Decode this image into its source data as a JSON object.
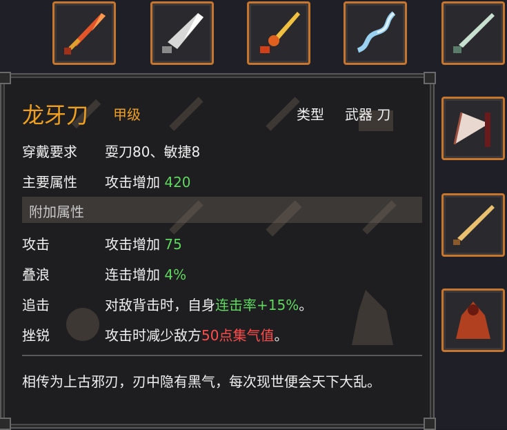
{
  "item": {
    "name": "龙牙刀",
    "grade": "甲级",
    "type_label": "类型",
    "type_value": "武器 刀",
    "requirement_label": "穿戴要求",
    "requirement_value": "耍刀80、敏捷8",
    "main_attr_label": "主要属性",
    "main_attr_text": "攻击增加 ",
    "main_attr_value": "420",
    "extra_header": "附加属性",
    "extras": [
      {
        "label": "攻击",
        "text": "攻击增加 ",
        "value": "75"
      },
      {
        "label": "叠浪",
        "text": "连击增加 ",
        "value": "4%"
      },
      {
        "label": "追击",
        "text_pre": "对敌背击时，自身",
        "highlight": "连击率+15%",
        "text_post": "。"
      },
      {
        "label": "挫锐",
        "text_pre": "攻击时减少敌方",
        "highlight": "50点集气值",
        "text_post": "。"
      }
    ],
    "description": "相传为上古邪刃，刃中隐有黑气，每次现世便会天下大乱。"
  },
  "colors": {
    "accent_gold": "#f0a020",
    "value_green": "#5fd85f",
    "value_red": "#ff4d4d",
    "slot_border": "#c8762c"
  },
  "slots": [
    {
      "icon": "red-sword-icon"
    },
    {
      "icon": "broadsword-icon"
    },
    {
      "icon": "golden-dagger-icon"
    },
    {
      "icon": "serpent-blade-icon"
    },
    {
      "icon": "spear-blade-icon"
    },
    {
      "icon": "fan-icon"
    },
    {
      "icon": "golden-spear-icon"
    },
    {
      "icon": "red-cloak-icon"
    }
  ]
}
